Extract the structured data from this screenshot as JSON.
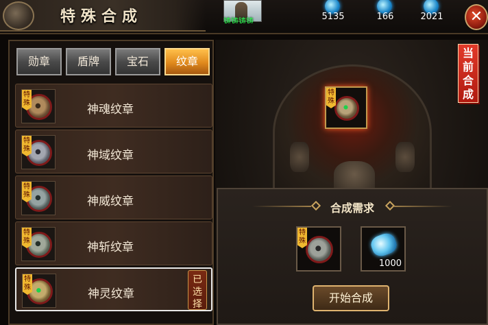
{
  "header": {
    "title": "特殊合成",
    "player_name": "铸铸铸铸",
    "resources": [
      {
        "icon": "blue-gem-icon",
        "value": "5135"
      },
      {
        "icon": "blue-gem-icon",
        "value": "166"
      },
      {
        "icon": "blue-gem-icon",
        "value": "2021"
      }
    ],
    "close_label": "✕"
  },
  "tabs": [
    {
      "label": "勋章",
      "active": false
    },
    {
      "label": "盾牌",
      "active": false
    },
    {
      "label": "宝石",
      "active": false
    },
    {
      "label": "纹章",
      "active": true
    }
  ],
  "items": [
    {
      "name": "神魂纹章",
      "tag": "特殊",
      "medal_color": "#8a6a4a"
    },
    {
      "name": "神域纹章",
      "tag": "特殊",
      "medal_color": "#7d7f86"
    },
    {
      "name": "神威纹章",
      "tag": "特殊",
      "medal_color": "#6f7777"
    },
    {
      "name": "神斩纹章",
      "tag": "特殊",
      "medal_color": "#6e7d6e"
    },
    {
      "name": "神灵纹章",
      "tag": "特殊",
      "medal_color": "#8d7a48",
      "selected": true,
      "selected_label": "已选择"
    }
  ],
  "current": {
    "label": "当前合成",
    "tag": "特殊"
  },
  "requirements": {
    "title": "合成需求",
    "slots": [
      {
        "type": "medal",
        "tag": "特殊"
      },
      {
        "type": "stone",
        "quantity": "1000"
      }
    ],
    "button_label": "开始合成"
  }
}
